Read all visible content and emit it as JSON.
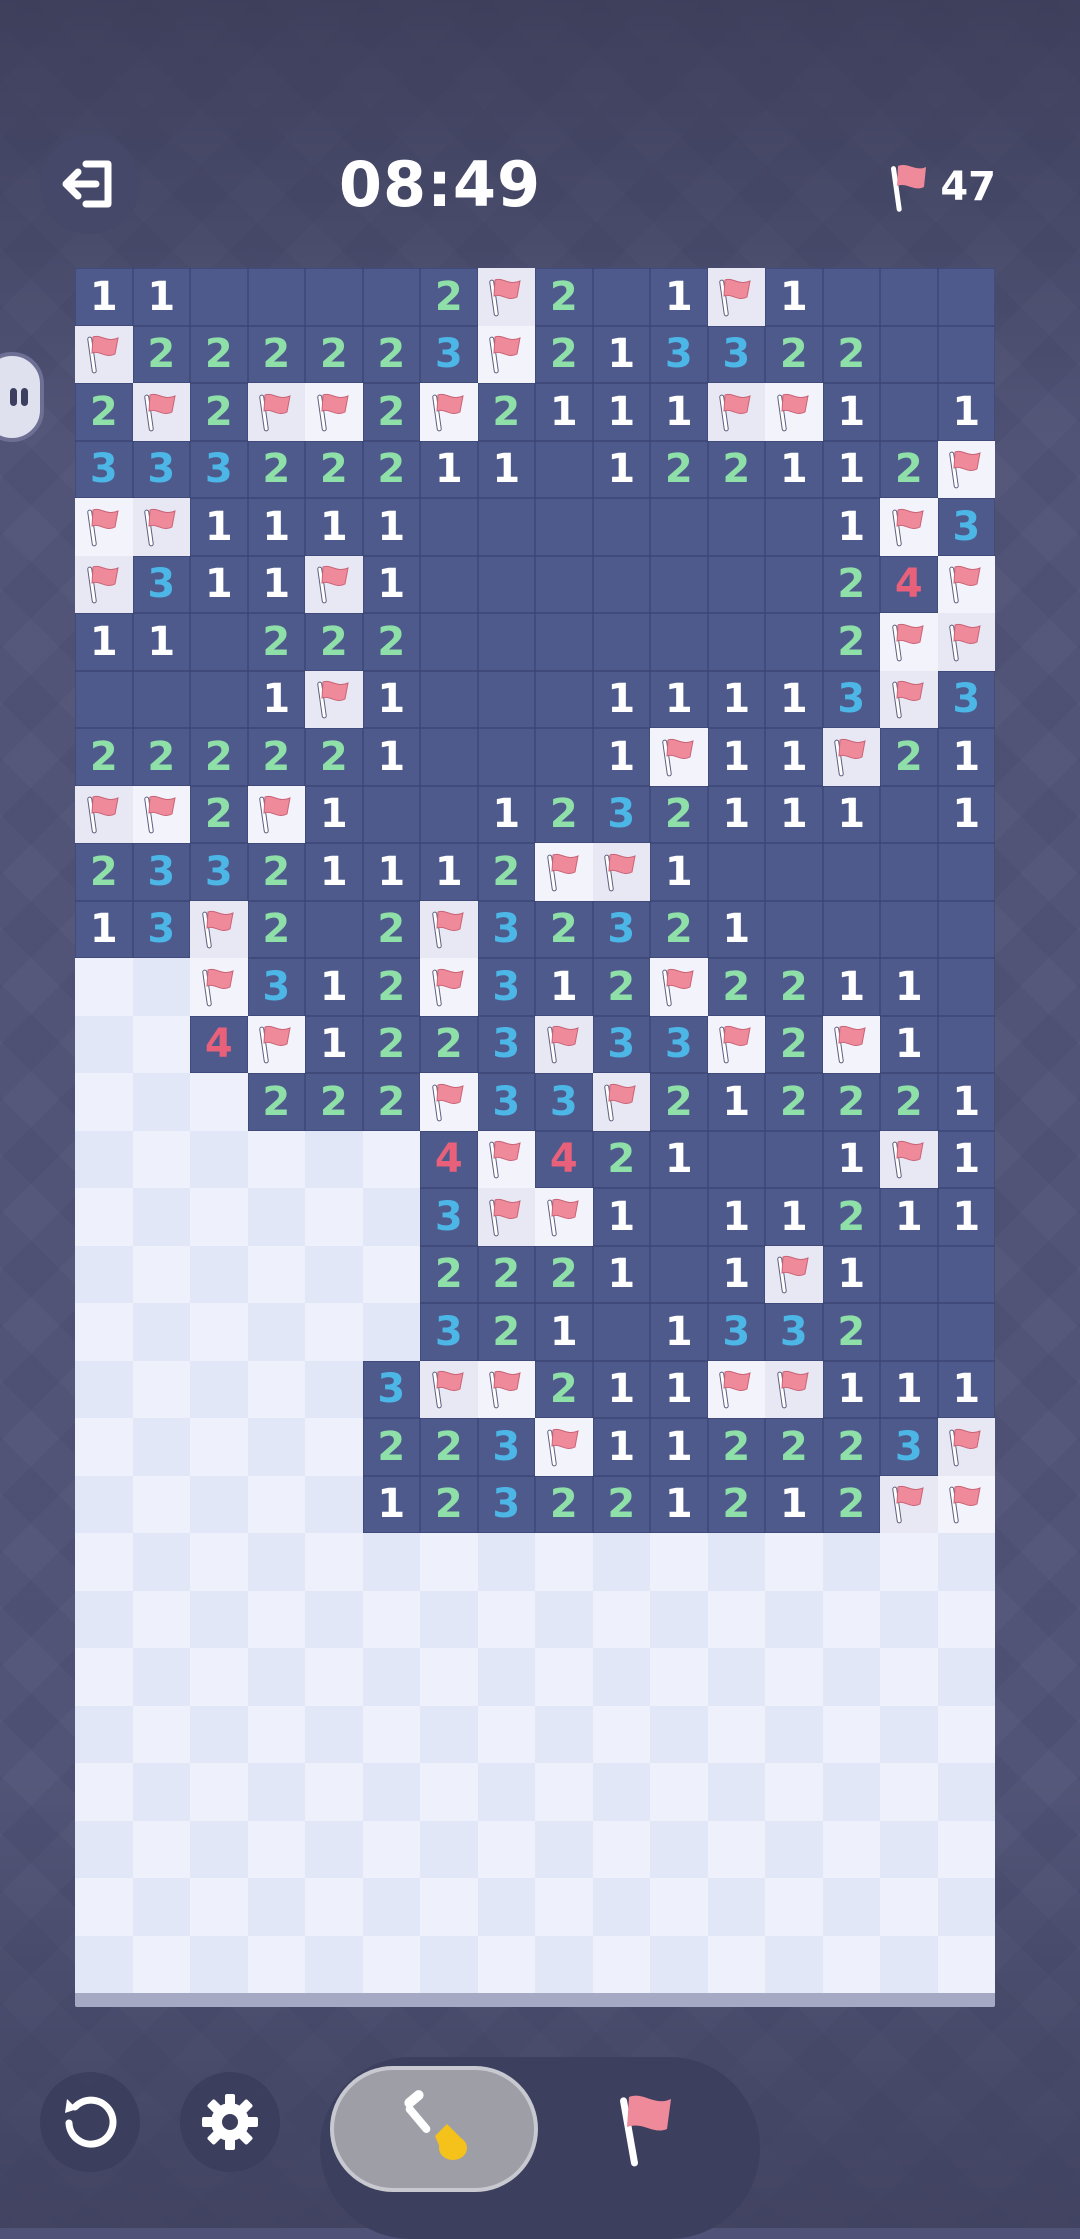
{
  "header": {
    "timer": "08:49",
    "flags_remaining": "47"
  },
  "board": {
    "cols": 16,
    "rows": 30,
    "legend": "F = flag, . = open empty, # = unrevealed, digit = mine count",
    "grid": [
      "11....2F2.1F1...",
      "F222223F213322..",
      "2F2FF2F2111FF1.11",
      "33322211.122112F",
      "FF1111.......1F3",
      "F311F1.......24F",
      "11.222.......2FF",
      "...1F1...11113F3",
      "222221...1F11F21",
      "FF2F1..1232111.1",
      "23321112FF1.....",
      "13F2.2F32321....",
      "##F312F312F2211.",
      "##4F1223F33F2F1.",
      "###222F33F21222 1",
      "######4F421..1F1",
      "######3FF1.1121 1",
      "######2221.1F1..",
      "######321.1332..",
      "#####3FF211FF111",
      "#####223F11222 3F",
      "#####1232212 12FF",
      "################",
      "################",
      "################",
      "################",
      "################",
      "################",
      "################",
      "################"
    ]
  },
  "colors": {
    "num1": "#ffffff",
    "num2": "#8ee0a8",
    "num3": "#4cb6e6",
    "num4": "#e8607a",
    "flag": "#ef8a9a",
    "open": "#4e5a8c"
  },
  "controls": {
    "exit": "exit-icon",
    "restart": "restart-icon",
    "settings": "gear-icon",
    "mode_dig": "shovel-icon",
    "mode_flag": "flag-icon"
  }
}
